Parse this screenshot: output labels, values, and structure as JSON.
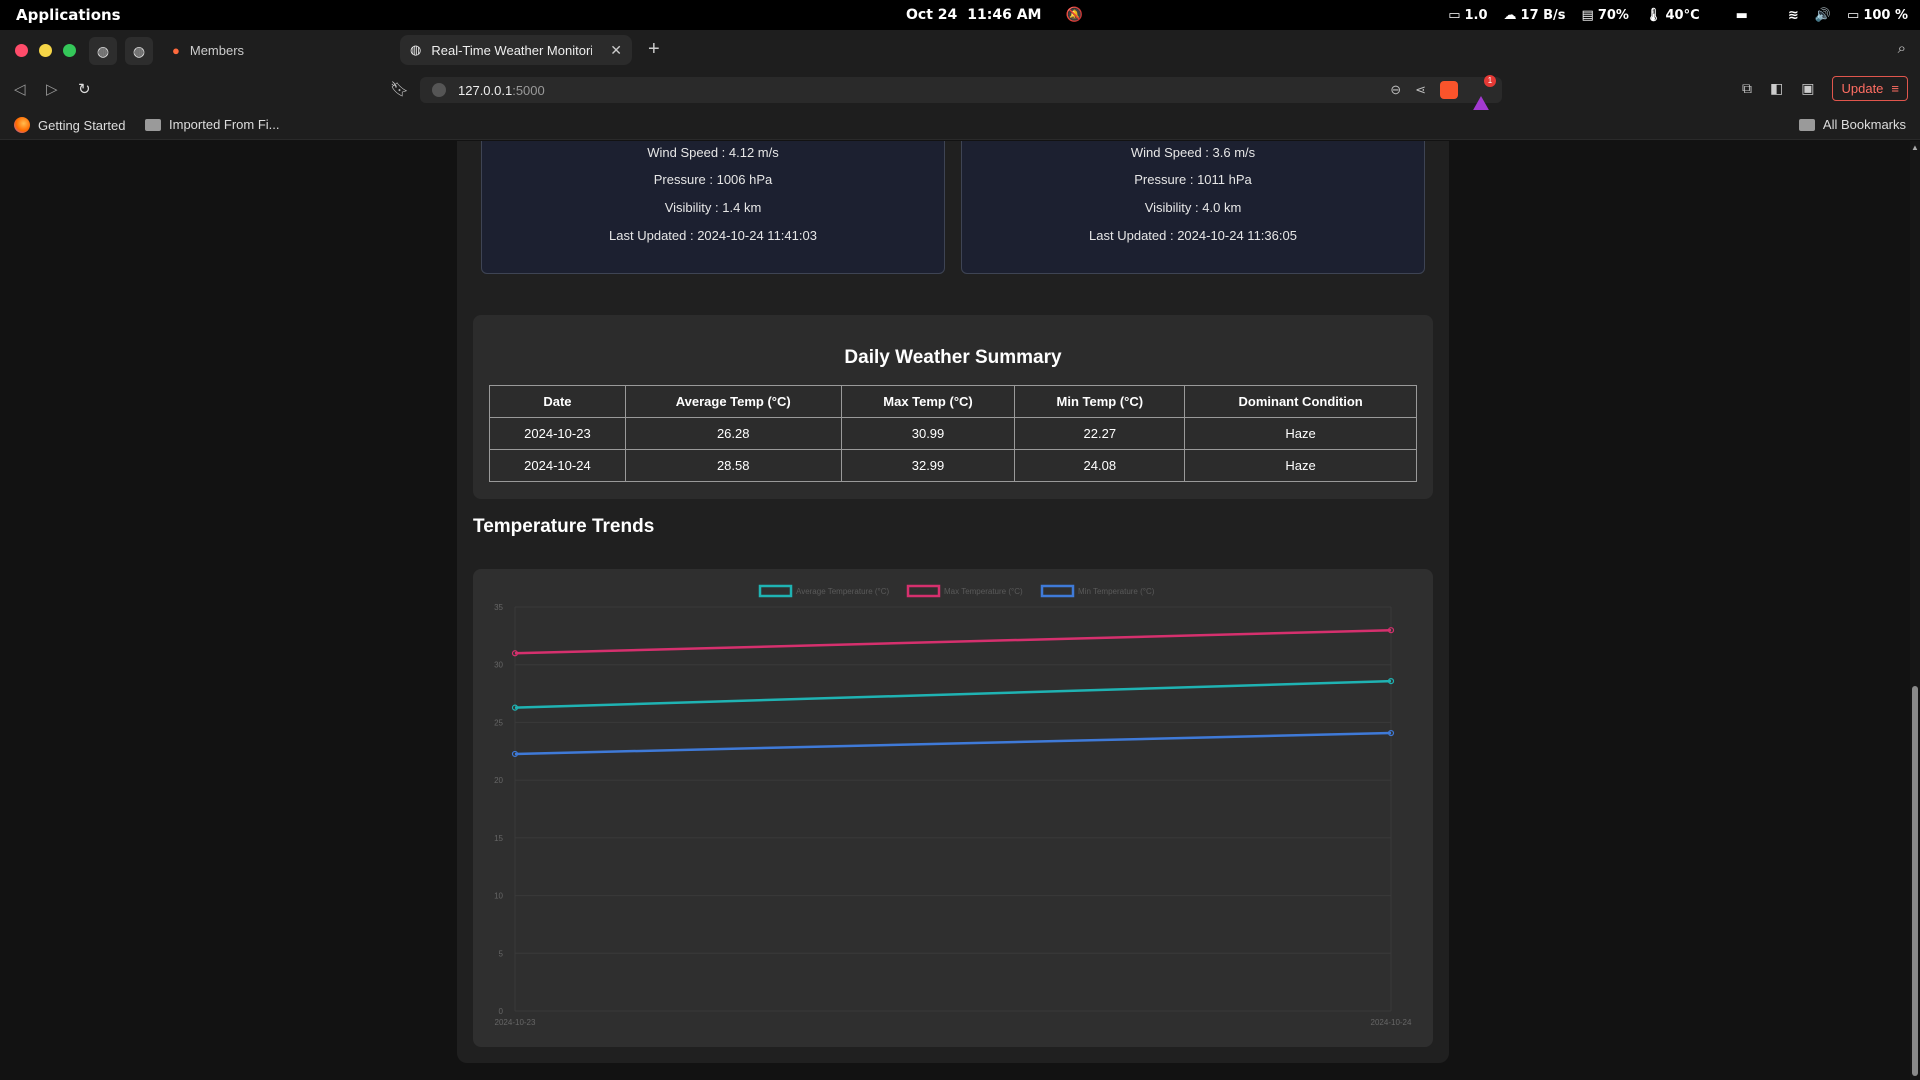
{
  "os": {
    "apps_label": "Applications",
    "date": "Oct 24",
    "time": "11:46 AM",
    "load": "1.0",
    "net": "17 B/s",
    "mem": "70%",
    "temp": "40°C",
    "battery": "100 %"
  },
  "browser": {
    "tabs": [
      {
        "label": "Members"
      },
      {
        "label": "Real-Time Weather Monitori"
      }
    ],
    "url_host": "127.0.0.1",
    "url_port": ":5000",
    "update_label": "Update",
    "rewards_count": "1",
    "bookmarks": [
      {
        "label": "Getting Started"
      },
      {
        "label": "Imported From Fi..."
      }
    ],
    "all_bookmarks": "All Bookmarks"
  },
  "cards": [
    {
      "wind": "Wind Speed : 4.12 m/s",
      "pressure": "Pressure : 1006 hPa",
      "visibility": "Visibility : 1.4 km",
      "updated": "Last Updated : 2024-10-24 11:41:03"
    },
    {
      "wind": "Wind Speed : 3.6 m/s",
      "pressure": "Pressure : 1011 hPa",
      "visibility": "Visibility : 4.0 km",
      "updated": "Last Updated : 2024-10-24 11:36:05"
    }
  ],
  "summary": {
    "title": "Daily Weather Summary",
    "headers": [
      "Date",
      "Average Temp (°C)",
      "Max Temp (°C)",
      "Min Temp (°C)",
      "Dominant Condition"
    ],
    "rows": [
      [
        "2024-10-23",
        "26.28",
        "30.99",
        "22.27",
        "Haze"
      ],
      [
        "2024-10-24",
        "28.58",
        "32.99",
        "24.08",
        "Haze"
      ]
    ]
  },
  "trends_title": "Temperature Trends",
  "chart_data": {
    "type": "line",
    "categories": [
      "2024-10-23",
      "2024-10-24"
    ],
    "series": [
      {
        "name": "Average Temperature (°C)",
        "values": [
          26.28,
          28.58
        ],
        "color": "#1fb3b3"
      },
      {
        "name": "Max Temperature (°C)",
        "values": [
          30.99,
          32.99
        ],
        "color": "#d6306e"
      },
      {
        "name": "Min Temperature (°C)",
        "values": [
          22.27,
          24.08
        ],
        "color": "#3f7ad8"
      }
    ],
    "ylim": [
      0,
      35
    ],
    "yticks": [
      0,
      5,
      10,
      15,
      20,
      25,
      30,
      35
    ],
    "legend": "top",
    "grid": true
  }
}
